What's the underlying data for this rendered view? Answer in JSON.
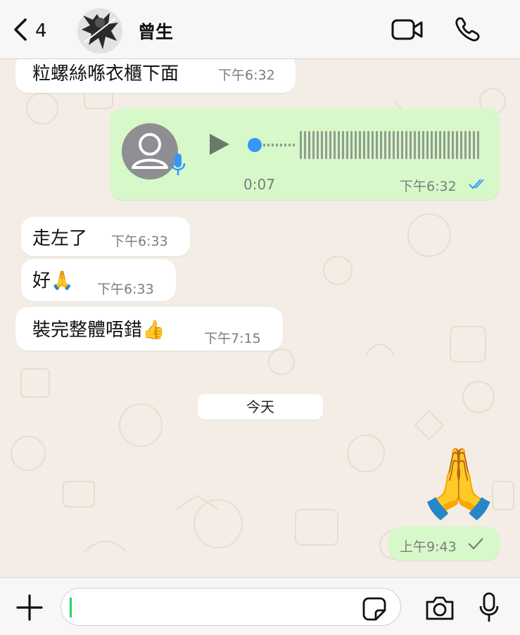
{
  "header": {
    "back_count": "4",
    "contact_name": "曾生",
    "icons": {
      "back": "chevron-left-icon",
      "video": "video-call-icon",
      "call": "phone-icon"
    }
  },
  "messages": [
    {
      "direction": "incoming",
      "text": "粒螺絲喺衣櫃下面",
      "time": "下午6:32"
    },
    {
      "direction": "outgoing",
      "type": "voice",
      "duration": "0:07",
      "time": "下午6:32",
      "status": "read"
    },
    {
      "direction": "incoming",
      "text": "走左了",
      "time": "下午6:33"
    },
    {
      "direction": "incoming",
      "text": "好🙏",
      "time": "下午6:33"
    },
    {
      "direction": "incoming",
      "text": "裝完整體唔錯👍",
      "time": "下午7:15"
    }
  ],
  "date_divider": "今天",
  "last_message": {
    "direction": "outgoing",
    "type": "emoji",
    "emoji": "🙏",
    "time": "上午9:43",
    "status": "sent"
  },
  "colors": {
    "outgoing_bubble": "#d7f8c9",
    "incoming_bubble": "#ffffff",
    "read_ticks": "#3497f9",
    "voice_dot": "#3497f9",
    "mic_badge": "#3497f9",
    "wallpaper": "#f3ede5"
  },
  "input": {
    "placeholder": ""
  },
  "bottom_icons": {
    "attach": "plus-icon",
    "sticker": "sticker-icon",
    "camera": "camera-icon",
    "mic": "microphone-icon"
  }
}
